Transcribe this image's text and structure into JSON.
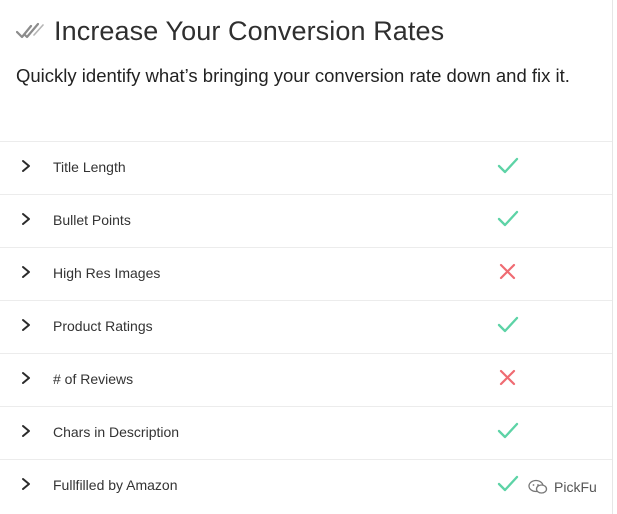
{
  "header": {
    "title": "Increase Your Conversion Rates",
    "subtitle": "Quickly identify what’s bringing your conversion rate down and fix it."
  },
  "colors": {
    "pass": "#5dd3a6",
    "fail": "#ef6b72",
    "title_icon": "#8c8c8c"
  },
  "rows": [
    {
      "label": "Title Length",
      "status": "pass",
      "icon": "check-icon"
    },
    {
      "label": "Bullet Points",
      "status": "pass",
      "icon": "check-icon"
    },
    {
      "label": "High Res Images",
      "status": "fail",
      "icon": "cross-icon"
    },
    {
      "label": "Product Ratings",
      "status": "pass",
      "icon": "check-icon"
    },
    {
      "label": "# of Reviews",
      "status": "fail",
      "icon": "cross-icon"
    },
    {
      "label": "Chars in Description",
      "status": "pass",
      "icon": "check-icon"
    },
    {
      "label": "Fullfilled by Amazon",
      "status": "pass",
      "icon": "check-icon"
    }
  ],
  "watermark": {
    "text": "PickFu",
    "icon": "wechat-icon"
  }
}
